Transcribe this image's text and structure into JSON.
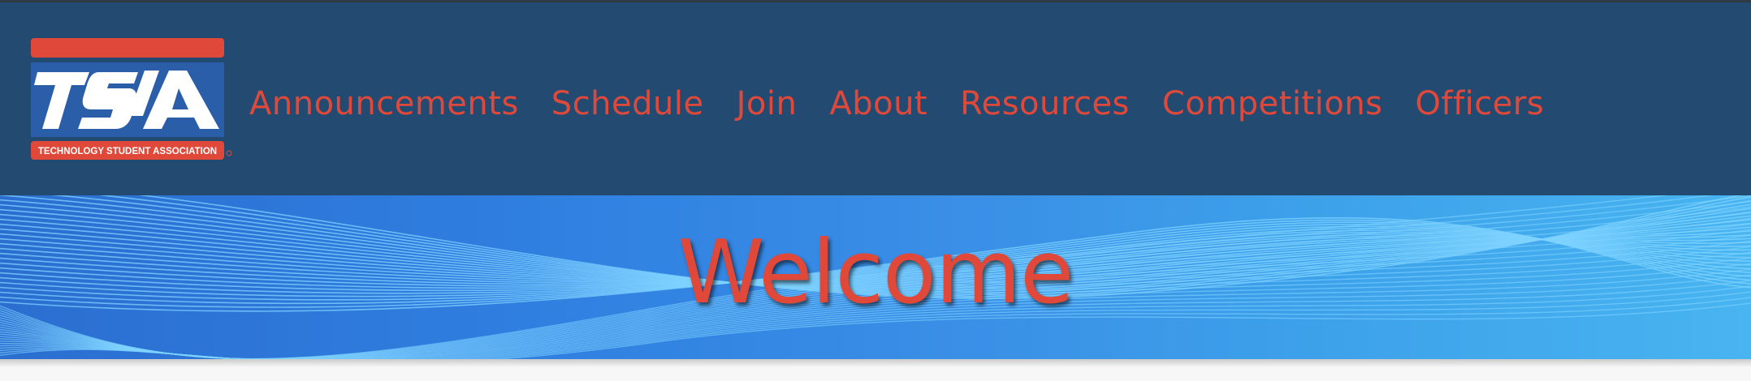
{
  "header": {
    "logo": {
      "name": "tsa-logo",
      "wordmark": "TSA",
      "tagline": "TECHNOLOGY STUDENT ASSOCIATION",
      "colors": {
        "red": "#e0493a",
        "blue": "#2a5ea8",
        "white": "#ffffff"
      }
    },
    "nav": [
      {
        "label": "Announcements"
      },
      {
        "label": "Schedule"
      },
      {
        "label": "Join"
      },
      {
        "label": "About"
      },
      {
        "label": "Resources"
      },
      {
        "label": "Competitions"
      },
      {
        "label": "Officers"
      }
    ],
    "colors": {
      "background": "#234a71",
      "nav_text": "#e0493a"
    }
  },
  "banner": {
    "title": "Welcome",
    "colors": {
      "title": "#e0493a",
      "background": "#2f7fe0",
      "lines": "#7fd3ff"
    }
  }
}
